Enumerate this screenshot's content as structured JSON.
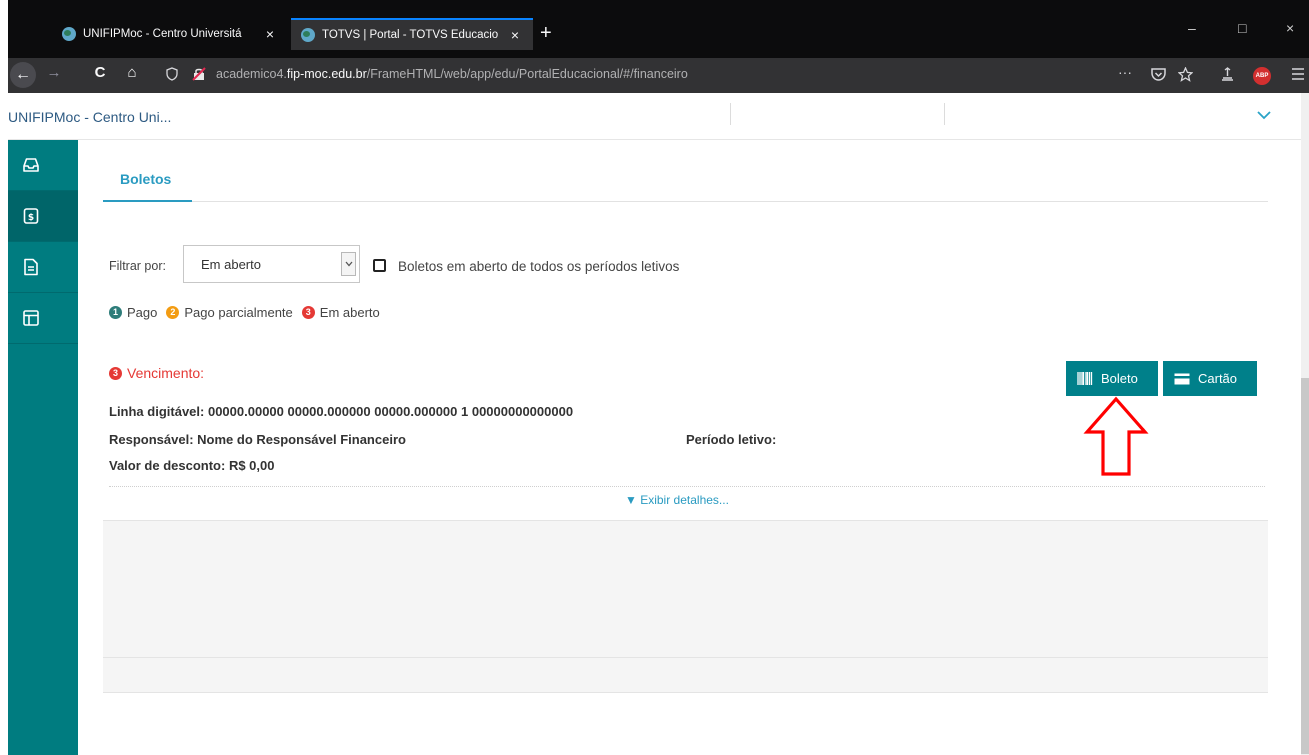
{
  "browser": {
    "tabs": [
      {
        "title": "UNIFIPMoc - Centro Universitá",
        "close": "×"
      },
      {
        "title": "TOTVS | Portal - TOTVS Educacio",
        "close": "×"
      }
    ],
    "new_tab": "+",
    "window_controls": {
      "minimize": "–",
      "maximize": "□",
      "close": "×"
    },
    "url": {
      "prefix": "academico4.",
      "domain": "fip-moc.edu.br",
      "path": "/FrameHTML/web/app/edu/PortalEducacional/#/financeiro"
    },
    "nav": {
      "back": "←",
      "forward": "→",
      "reload": "C",
      "home": "⌂",
      "more": "···",
      "abp": "ABP"
    }
  },
  "app": {
    "institution": "UNIFIPMoc - Centro Uni...",
    "chevron": "⌄"
  },
  "sidebar": {
    "items": [
      {
        "icon": "inbox-icon"
      },
      {
        "icon": "payment-icon",
        "active": true
      },
      {
        "icon": "document-icon"
      },
      {
        "icon": "layout-icon"
      }
    ]
  },
  "main": {
    "tab_label": "Boletos",
    "filter": {
      "label": "Filtrar por:",
      "selected": "Em aberto",
      "checkbox_label": "Boletos em aberto de todos os períodos letivos"
    },
    "legend": [
      {
        "number": "1",
        "label": "Pago",
        "color": "#2e7d7a"
      },
      {
        "number": "2",
        "label": "Pago parcialmente",
        "color": "#f39c12"
      },
      {
        "number": "3",
        "label": "Em aberto",
        "color": "#e53935"
      }
    ],
    "boleto": {
      "status_number": "3",
      "vencimento_label": "Vencimento:",
      "linha_label": "Linha digitável:",
      "linha_value": "00000.00000 00000.000000 00000.000000 1 00000000000000",
      "responsavel_label": "Responsável:",
      "responsavel_value": "Nome do Responsável Financeiro",
      "periodo_label": "Período letivo:",
      "desconto_label": "Valor de desconto:",
      "desconto_value": "R$ 0,00",
      "details_link": "▼ Exibir detalhes..."
    },
    "buttons": {
      "boleto": "Boleto",
      "cartao": "Cartão"
    }
  }
}
